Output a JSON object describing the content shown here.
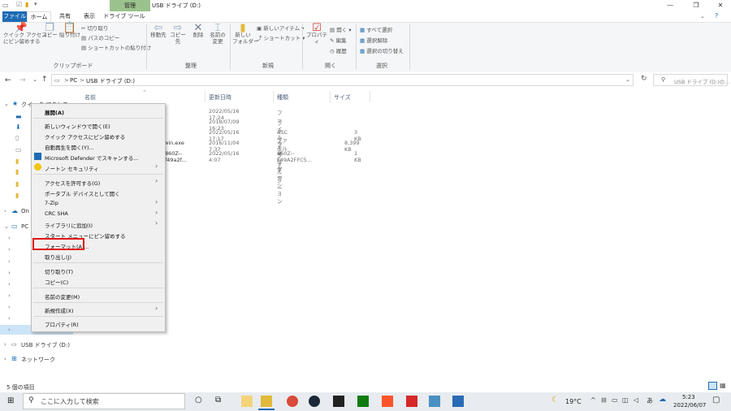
{
  "titlebar": {
    "manage_tab": "管理",
    "title": "USB ドライブ (D:)"
  },
  "ribbon_tabs": {
    "file": "ファイル",
    "home": "ホーム",
    "share": "共有",
    "view": "表示",
    "drive_tools": "ドライブ ツール"
  },
  "ribbon": {
    "pin_quick": "クイック アクセス\nにピン留めする",
    "copy": "コピー",
    "paste": "貼り付け",
    "cut": "切り取り",
    "copy_path": "パスのコピー",
    "paste_shortcut": "ショートカットの貼り付け",
    "clipboard_group": "クリップボード",
    "move_to": "移動先",
    "copy_to": "コピー先",
    "delete": "削除",
    "rename": "名前の\n変更",
    "organize_group": "整理",
    "new_folder": "新しい\nフォルダー",
    "new_item": "新しいアイテム",
    "shortcut": "ショートカット",
    "new_group": "新規",
    "properties": "プロパティ",
    "open": "開く",
    "edit": "編集",
    "history": "履歴",
    "open_group": "開く",
    "select_all": "すべて選択",
    "select_none": "選択解除",
    "invert_select": "選択の切り替え",
    "select_group": "選択"
  },
  "address": {
    "pc": "PC",
    "sep": ">",
    "drive": "USB ドライブ (D:)",
    "search_placeholder": "USB ドライブ (D:)の..."
  },
  "columns": {
    "name": "名前",
    "modified": "更新日時",
    "type": "種類",
    "size": "サイズ"
  },
  "files": [
    {
      "name": "",
      "modified": "2022/05/16 17:24",
      "type": "ファイル フォルダー",
      "size": ""
    },
    {
      "name": "",
      "modified": "2018/07/09 16:23",
      "type": "ファイル フォルダー",
      "size": ""
    },
    {
      "name": "",
      "modified": "2022/05/16 17:17",
      "type": "ASC ファイル",
      "size": "3 KB"
    },
    {
      "name": "win.exe",
      "modified": "2016/11/04 7:37",
      "type": "アプリケーション",
      "size": "8,399 KB"
    },
    {
      "name": "860Z--f49a2f...",
      "modified": "2022/05/16 4:07",
      "type": "860Z--F49A2FFC5...",
      "size": "1 KB"
    }
  ],
  "nav": {
    "quick": "クイック アクセス",
    "onedrive": "On",
    "pc": "PC",
    "usb": "USB ドライブ (D:)",
    "network": "ネットワーク"
  },
  "context_menu": {
    "expand": "展開(A)",
    "open_new_window": "新しいウィンドウで開く(E)",
    "pin_quick": "クイック アクセスにピン留めする",
    "autoplay": "自動再生を開く(Y)...",
    "defender": "Microsoft Defender でスキャンする...",
    "norton": "ノートン セキュリティ",
    "give_access": "アクセスを許可する(G)",
    "portable": "ポータブル デバイスとして開く",
    "zip": "7-Zip",
    "crc": "CRC SHA",
    "library": "ライブラリに追加(I)",
    "pin_start": "スタート メニューにピン留めする",
    "format": "フォーマット(A)...",
    "eject": "取り出し(J)",
    "cut": "切り取り(T)",
    "copy": "コピー(C)",
    "rename": "名前の変更(M)",
    "new": "新規作成(X)",
    "properties": "プロパティ(R)"
  },
  "status": {
    "item_count": "5 個の項目"
  },
  "taskbar": {
    "search_placeholder": "ここに入力して検索",
    "weather": "19°C",
    "time": "5:23",
    "date": "2022/06/07"
  },
  "colors": {
    "file_tab": "#1e6bb5",
    "manage_tab": "#9bc28c",
    "highlight": "#e01717",
    "taskbar": "#e8ecf0"
  }
}
